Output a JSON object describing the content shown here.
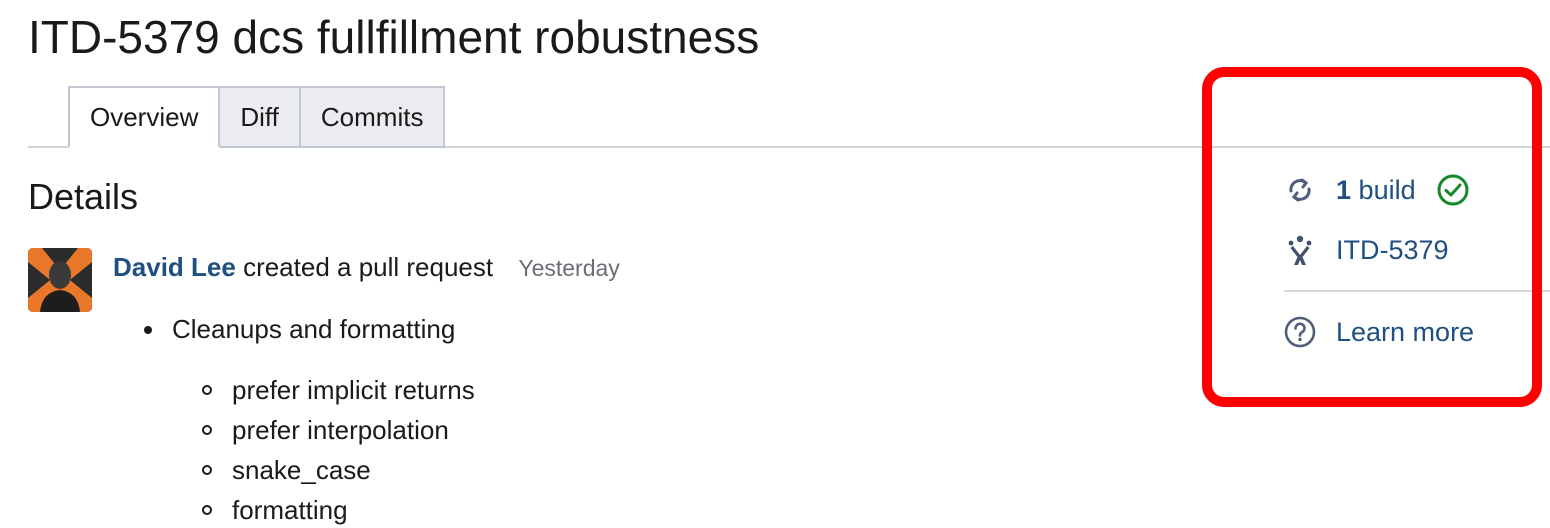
{
  "pull_request": {
    "title": "ITD-5379 dcs fullfillment robustness"
  },
  "tabs": [
    {
      "label": "Overview",
      "active": true
    },
    {
      "label": "Diff",
      "active": false
    },
    {
      "label": "Commits",
      "active": false
    }
  ],
  "details": {
    "heading": "Details",
    "activity": {
      "author": "David Lee",
      "action": "created a pull request",
      "time": "Yesterday"
    },
    "description": {
      "items": [
        "Cleanups and formatting"
      ],
      "sub_items": [
        "prefer implicit returns",
        "prefer interpolation",
        "snake_case",
        "formatting"
      ]
    }
  },
  "sidebar": {
    "builds": {
      "count": "1",
      "label": "build",
      "status": "passed",
      "status_icon": "check-circle-icon",
      "icon": "sync-icon"
    },
    "issue": {
      "label": "ITD-5379",
      "icon": "jira-icon"
    },
    "learn_more": {
      "label": "Learn more",
      "icon": "help-icon"
    }
  },
  "colors": {
    "link": "#205081",
    "success": "#14892c",
    "highlight": "#ff0000"
  }
}
